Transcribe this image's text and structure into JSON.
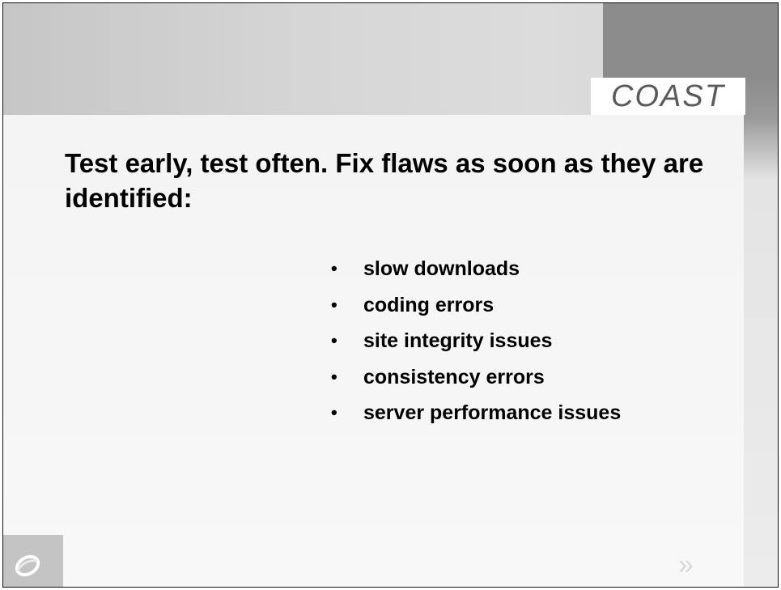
{
  "logo": {
    "text": "COAST"
  },
  "title": "Test early, test often.  Fix flaws as soon as they are identified:",
  "bullets": [
    "slow downloads",
    "coding errors",
    "site integrity issues",
    "consistency errors",
    "server performance issues"
  ],
  "bullet_glyph": "•",
  "next_glyph": "»",
  "colors": {
    "banner": "#cfcfcf",
    "banner_dark": "#8c8c8c",
    "logo_text": "#5a5a5a",
    "text": "#000000"
  },
  "icons": {
    "corner": "swirl-logo-icon",
    "next": "double-chevron-right-icon"
  }
}
